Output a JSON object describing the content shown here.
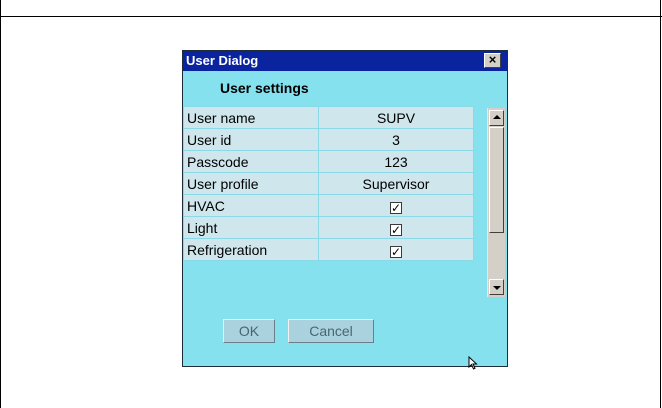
{
  "dialog": {
    "title": "User Dialog",
    "close_glyph": "×",
    "heading": "User settings",
    "rows": [
      {
        "label": "User name",
        "value": "SUPV",
        "type": "text"
      },
      {
        "label": "User id",
        "value": "3",
        "type": "text"
      },
      {
        "label": "Passcode",
        "value": "123",
        "type": "text"
      },
      {
        "label": "User profile",
        "value": "Supervisor",
        "type": "text"
      },
      {
        "label": "HVAC",
        "value": true,
        "type": "checkbox"
      },
      {
        "label": "Light",
        "value": true,
        "type": "checkbox"
      },
      {
        "label": "Refrigeration",
        "value": true,
        "type": "checkbox"
      }
    ],
    "ok_label": "OK",
    "cancel_label": "Cancel"
  },
  "colors": {
    "dialog_background": "#86e1ef",
    "titlebar": "#0a24a0",
    "table_background": "#cfe6ec"
  },
  "icons": {
    "close": "close-icon",
    "scroll_up": "scroll-up-arrow-icon",
    "scroll_down": "scroll-down-arrow-icon",
    "checkmark": "checkmark-icon",
    "cursor": "mouse-cursor-icon"
  }
}
